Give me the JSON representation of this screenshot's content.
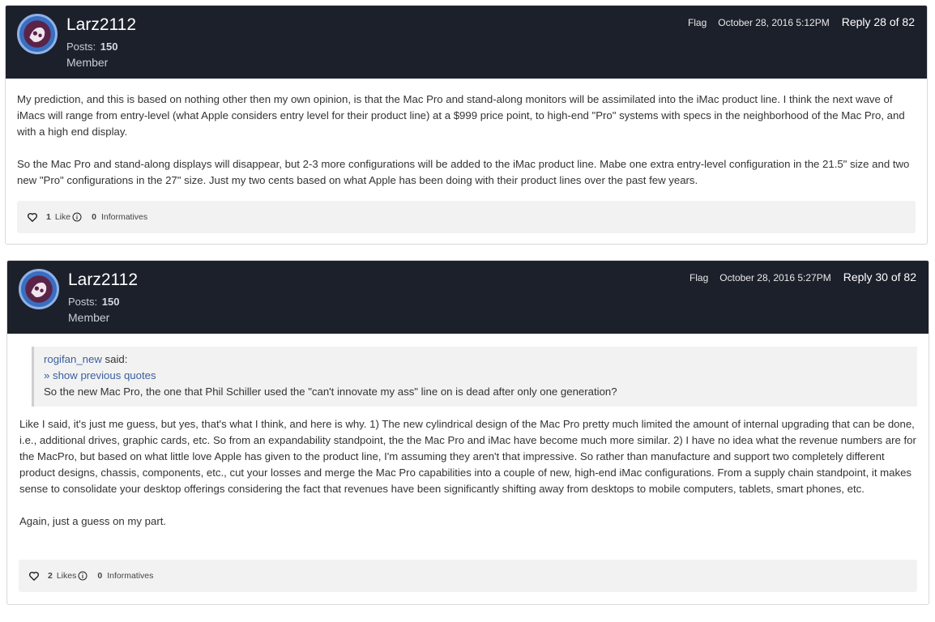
{
  "posts": [
    {
      "username": "Larz2112",
      "posts_label": "Posts:",
      "posts_count": "150",
      "rank": "Member",
      "flag_label": "Flag",
      "date": "October 28, 2016 5:12PM",
      "reply": "Reply 28 of 82",
      "paragraphs": [
        "My prediction, and this is based on nothing other then my own opinion, is that the Mac Pro and stand-along monitors will be assimilated into the iMac product line. I think the next wave of iMacs will range from entry-level (what Apple considers entry level for their product line) at a $999 price point, to high-end \"Pro\" systems with specs in the neighborhood of the Mac Pro, and with a high end display.",
        "So the Mac Pro and stand-along displays will disappear, but 2-3 more configurations will be added to the iMac product line. Mabe one extra entry-level configuration in the 21.5\" size and two new \"Pro\" configurations in the 27\" size. Just my two cents based on what Apple has been doing with their product lines over the past few years."
      ],
      "likes_count": "1",
      "likes_label": "Like",
      "informatives_count": "0",
      "informatives_label": "Informatives"
    },
    {
      "username": "Larz2112",
      "posts_label": "Posts:",
      "posts_count": "150",
      "rank": "Member",
      "flag_label": "Flag",
      "date": "October 28, 2016 5:27PM",
      "reply": "Reply 30 of 82",
      "quote": {
        "author": "rogifan_new",
        "said": " said:",
        "show_previous": "» show previous quotes",
        "text": "So the new Mac Pro, the one that Phil Schiller used the \"can't innovate my ass\" line on is dead after only one generation?"
      },
      "paragraphs": [
        "Like I said, it's just me guess, but yes, that's what I think, and here is why. 1) The new cylindrical design of the Mac Pro pretty much limited the amount of internal upgrading that can be done, i.e., additional drives, graphic cards, etc.  So from an expandability standpoint, the the Mac Pro and iMac have become much more similar. 2) I have no idea what the revenue numbers are for the MacPro, but based on what little love Apple has given to the product line, I'm assuming they aren't that impressive. So rather than manufacture and support two completely different product designs, chassis, components, etc., cut your losses and merge the Mac Pro capabilities into a couple of new, high-end iMac configurations. From a supply chain standpoint, it makes sense to consolidate your desktop offerings considering the fact that revenues have been significantly shifting away from desktops to mobile computers, tablets, smart phones, etc.",
        "Again, just a guess on my part."
      ],
      "likes_count": "2",
      "likes_label": "Likes",
      "informatives_count": "0",
      "informatives_label": "Informatives"
    }
  ],
  "colors": {
    "header_bg": "#1c202b",
    "link": "#3a5f9f",
    "reaction_bar": "#f2f2f2"
  },
  "icons": {
    "avatar": "avatar-icon",
    "like": "heart-icon",
    "info": "info-icon"
  }
}
